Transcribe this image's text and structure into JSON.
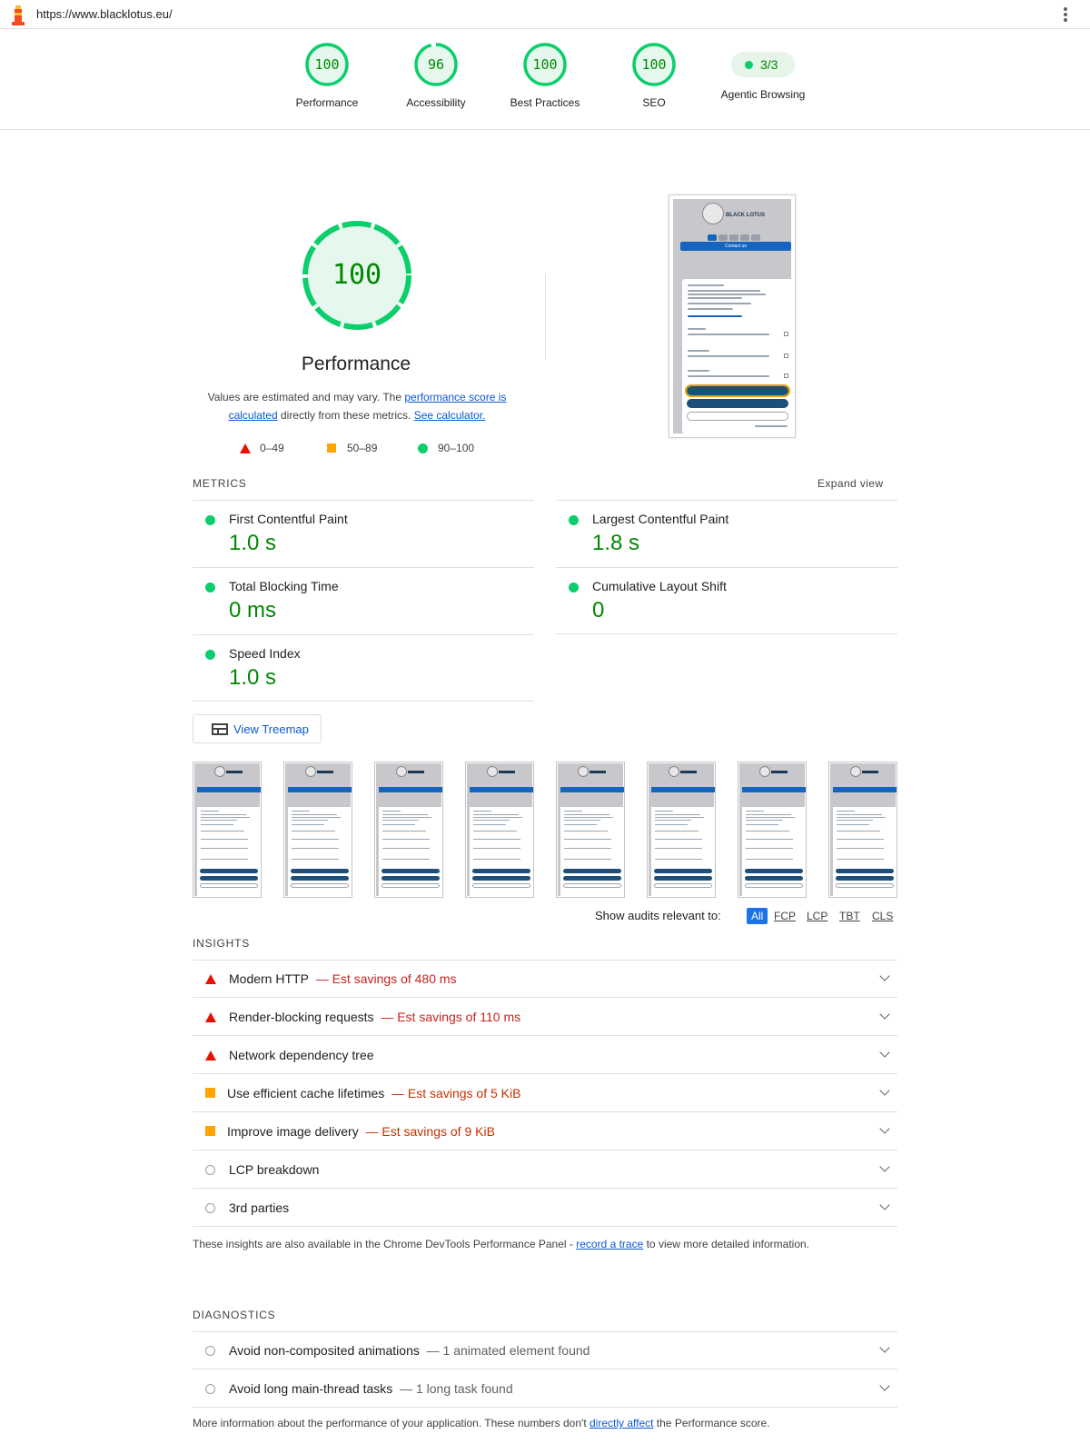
{
  "topbar": {
    "url": "https://www.blacklotus.eu/"
  },
  "scores": [
    {
      "value": "100",
      "label": "Performance",
      "score": 100
    },
    {
      "value": "96",
      "label": "Accessibility",
      "score": 96
    },
    {
      "value": "100",
      "label": "Best Practices",
      "score": 100
    },
    {
      "value": "100",
      "label": "SEO",
      "score": 100
    }
  ],
  "agentic": {
    "value": "3/3",
    "label": "Agentic Browsing"
  },
  "performance": {
    "score": "100",
    "title": "Performance",
    "desc_1": "Values are estimated and may vary. The ",
    "desc_link_1": "performance score is calculated",
    "desc_2": " directly from these metrics. ",
    "desc_link_2": "See calculator."
  },
  "legend": {
    "fail": "0–49",
    "average": "50–89",
    "pass": "90–100"
  },
  "screenshot": {
    "brand": "BLACK LOTUS",
    "cta": "Contact us"
  },
  "metrics": {
    "title": "METRICS",
    "expand": "Expand view",
    "items": [
      {
        "name": "First Contentful Paint",
        "value": "1.0 s"
      },
      {
        "name": "Largest Contentful Paint",
        "value": "1.8 s"
      },
      {
        "name": "Total Blocking Time",
        "value": "0 ms"
      },
      {
        "name": "Cumulative Layout Shift",
        "value": "0"
      },
      {
        "name": "Speed Index",
        "value": "1.0 s"
      }
    ]
  },
  "treemap": {
    "label": "View Treemap"
  },
  "filter": {
    "label": "Show audits relevant to:",
    "chips": [
      "All",
      "FCP",
      "LCP",
      "TBT",
      "CLS"
    ]
  },
  "insights": {
    "title": "INSIGHTS",
    "items": [
      {
        "title": "Modern HTTP",
        "savings": "— Est savings of 480 ms"
      },
      {
        "title": "Render-blocking requests",
        "savings": "— Est savings of 110 ms"
      },
      {
        "title": "Network dependency tree",
        "savings": ""
      },
      {
        "title": "Use efficient cache lifetimes",
        "savings": "— Est savings of 5 KiB"
      },
      {
        "title": "Improve image delivery",
        "savings": "— Est savings of 9 KiB"
      },
      {
        "title": "LCP breakdown",
        "savings": ""
      },
      {
        "title": "3rd parties",
        "savings": ""
      }
    ],
    "footer_1": "These insights are also available in the Chrome DevTools Performance Panel - ",
    "footer_link": "record a trace",
    "footer_2": " to view more detailed information."
  },
  "diagnostics": {
    "title": "DIAGNOSTICS",
    "items": [
      {
        "title": "Avoid non-composited animations",
        "detail": "— 1 animated element found"
      },
      {
        "title": "Avoid long main-thread tasks",
        "detail": "— 1 long task found"
      }
    ],
    "footer_1": "More information about the performance of your application. These numbers don't ",
    "footer_link": "directly affect",
    "footer_2": " the Performance score."
  },
  "colors": {
    "pass": "#0cce6b",
    "pass_text": "#008800",
    "fail": "#eb0f00",
    "average": "#ffa400",
    "link": "#0b57d0"
  }
}
